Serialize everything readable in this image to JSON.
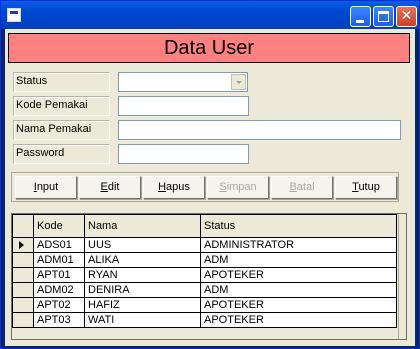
{
  "window": {
    "title": ""
  },
  "header": {
    "title": "Data User"
  },
  "form": {
    "fields": [
      {
        "label": "Status",
        "value": ""
      },
      {
        "label": "Kode Pemakai",
        "value": ""
      },
      {
        "label": "Nama Pemakai",
        "value": ""
      },
      {
        "label": "Password",
        "value": ""
      }
    ]
  },
  "buttons": [
    {
      "pre": "",
      "key": "I",
      "rest": "nput",
      "enabled": true
    },
    {
      "pre": "",
      "key": "E",
      "rest": "dit",
      "enabled": true
    },
    {
      "pre": "",
      "key": "H",
      "rest": "apus",
      "enabled": true
    },
    {
      "pre": "",
      "key": "S",
      "rest": "impan",
      "enabled": false
    },
    {
      "pre": "",
      "key": "B",
      "rest": "atal",
      "enabled": false
    },
    {
      "pre": "",
      "key": "T",
      "rest": "utup",
      "enabled": true
    }
  ],
  "grid": {
    "columns": [
      "Kode",
      "Nama",
      "Status"
    ],
    "rows": [
      [
        "ADS01",
        "UUS",
        "ADMINISTRATOR"
      ],
      [
        "ADM01",
        "ALIKA",
        "ADM"
      ],
      [
        "APT01",
        "RYAN",
        "APOTEKER"
      ],
      [
        "ADM02",
        "DENIRA",
        "ADM"
      ],
      [
        "APT02",
        "HAFIZ",
        "APOTEKER"
      ],
      [
        "APT03",
        "WATI",
        "APOTEKER"
      ]
    ],
    "current_row": 0
  }
}
